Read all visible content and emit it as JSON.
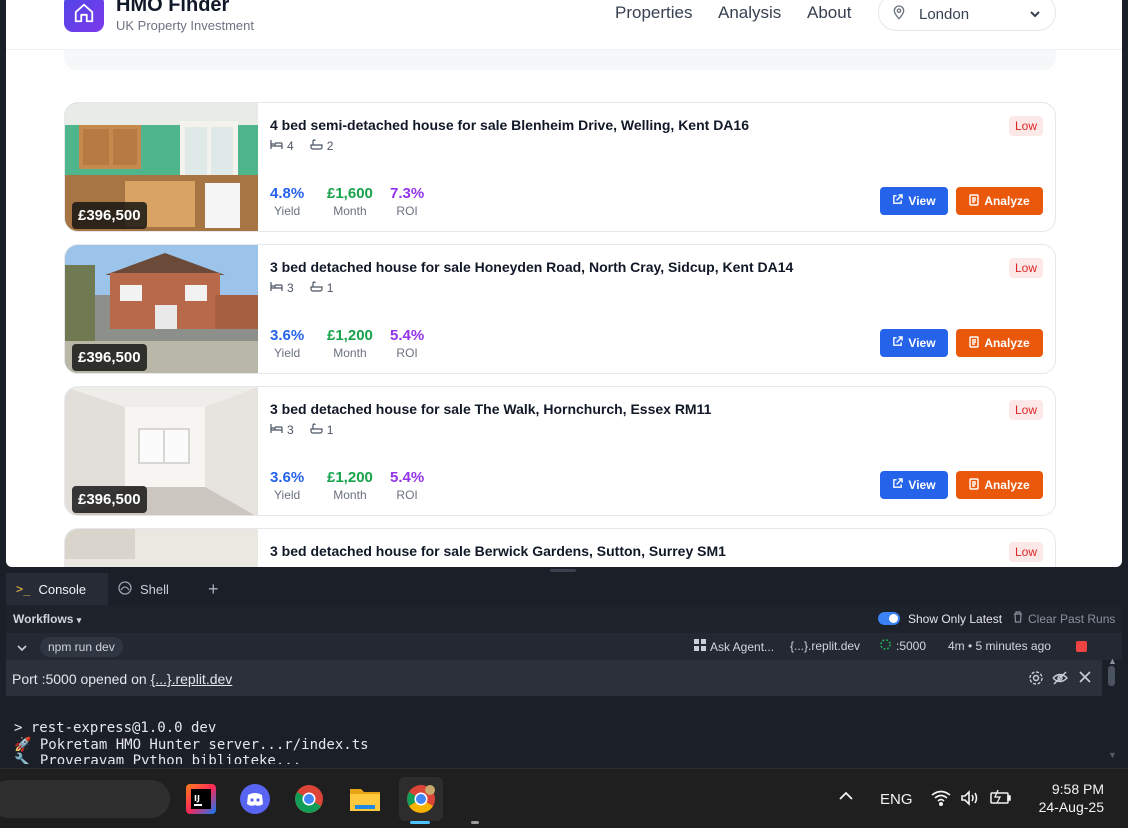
{
  "app": {
    "title": "HMO Finder",
    "subtitle": "UK Property Investment",
    "nav": [
      "Properties",
      "Analysis",
      "About"
    ],
    "location": "London"
  },
  "listings": [
    {
      "title": "4 bed semi-detached house for sale Blenheim Drive, Welling, Kent DA16",
      "beds": "4",
      "baths": "2",
      "price": "£396,500",
      "risk": "Low",
      "yield": "4.8%",
      "month": "£1,600",
      "roi": "7.3%"
    },
    {
      "title": "3 bed detached house for sale Honeyden Road, North Cray, Sidcup, Kent DA14",
      "beds": "3",
      "baths": "1",
      "price": "£396,500",
      "risk": "Low",
      "yield": "3.6%",
      "month": "£1,200",
      "roi": "5.4%"
    },
    {
      "title": "3 bed detached house for sale The Walk, Hornchurch, Essex RM11",
      "beds": "3",
      "baths": "1",
      "price": "£396,500",
      "risk": "Low",
      "yield": "3.6%",
      "month": "£1,200",
      "roi": "5.4%"
    },
    {
      "title": "3 bed detached house for sale Berwick Gardens, Sutton, Surrey SM1",
      "risk": "Low"
    }
  ],
  "labels": {
    "yield": "Yield",
    "month": "Month",
    "roi": "ROI",
    "view": "View",
    "analyze": "Analyze"
  },
  "colors": {
    "yield": "#2563eb",
    "month": "#16a34a",
    "roi": "#9333ea",
    "view_btn": "#2563eb",
    "analyze_btn": "#ea580c"
  },
  "console": {
    "tabs": [
      "Console",
      "Shell"
    ],
    "workflows_label": "Workflows",
    "show_only_latest": "Show Only Latest",
    "clear_past_runs": "Clear Past Runs",
    "run_name": "npm run dev",
    "ask_agent": "Ask Agent...",
    "domain": "{...}.replit.dev",
    "port": ":5000",
    "run_time": "4m • 5 minutes ago",
    "port_msg_prefix": "Port :5000 opened on ",
    "port_link": "{...}.replit.dev",
    "lines": [
      "> rest-express@1.0.0 dev",
      "🚀 Pokretam HMO Hunter server...r/index.ts",
      "🔧 Proveravam Python biblioteke..."
    ]
  },
  "taskbar": {
    "lang": "ENG",
    "time": "9:58 PM",
    "date": "24-Aug-25"
  }
}
